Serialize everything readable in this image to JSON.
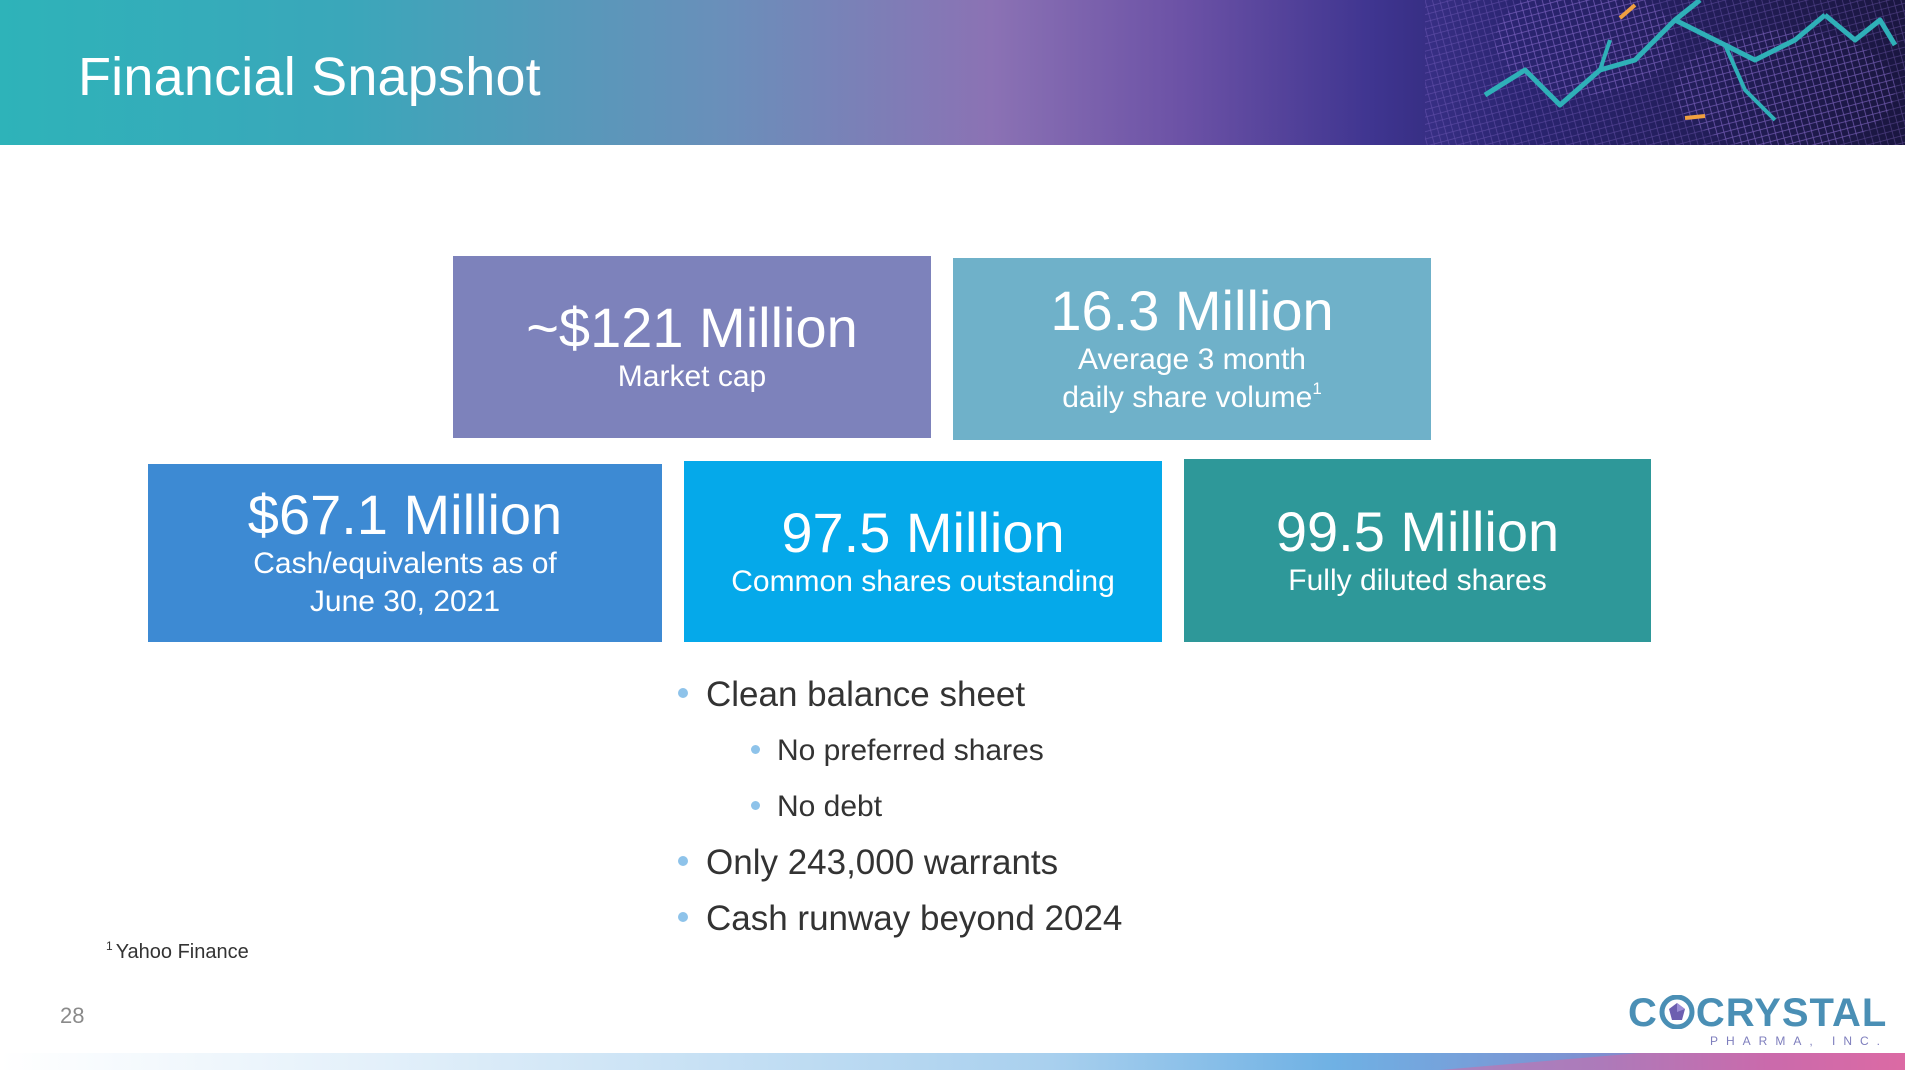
{
  "slide": {
    "title": "Financial Snapshot",
    "page_number": "28",
    "footnote_marker": "1",
    "footnote_text": "Yahoo Finance"
  },
  "stats": {
    "market_cap": {
      "value": "~$121 Million",
      "label": "Market cap",
      "color": "#7d82bb"
    },
    "share_volume": {
      "value": "16.3 Million",
      "label_line1": "Average 3 month",
      "label_line2": "daily share volume",
      "footnote_marker": "1",
      "color": "#6fb1c9"
    },
    "cash": {
      "value": "$67.1 Million",
      "label_line1": "Cash/equivalents as of",
      "label_line2": "June 30, 2021",
      "color": "#3d8ad3"
    },
    "common_shares": {
      "value": "97.5 Million",
      "label": "Common shares outstanding",
      "color": "#05a9ea"
    },
    "diluted_shares": {
      "value": "99.5 Million",
      "label": "Fully diluted shares",
      "color": "#2e9899"
    }
  },
  "bullets": {
    "b1": "Clean balance sheet",
    "b1a": "No preferred shares",
    "b1b": "No debt",
    "b2": "Only 243,000 warrants",
    "b3": "Cash runway beyond 2024"
  },
  "logo": {
    "word_left": "C",
    "word_right": "CRYSTAL",
    "subtitle": "PHARMA, INC.",
    "icon": "crystal-gem-icon",
    "color": "#4a8fb5"
  }
}
